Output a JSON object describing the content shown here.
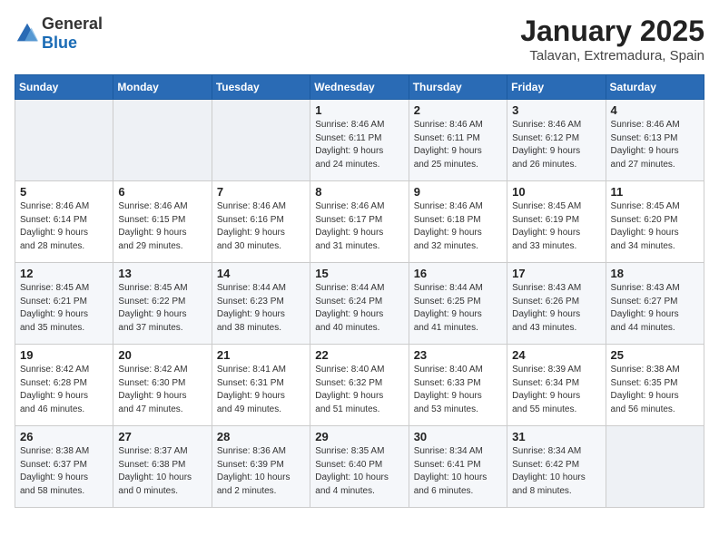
{
  "header": {
    "logo_general": "General",
    "logo_blue": "Blue",
    "title": "January 2025",
    "subtitle": "Talavan, Extremadura, Spain"
  },
  "days_of_week": [
    "Sunday",
    "Monday",
    "Tuesday",
    "Wednesday",
    "Thursday",
    "Friday",
    "Saturday"
  ],
  "weeks": [
    [
      {
        "day": "",
        "info": ""
      },
      {
        "day": "",
        "info": ""
      },
      {
        "day": "",
        "info": ""
      },
      {
        "day": "1",
        "info": "Sunrise: 8:46 AM\nSunset: 6:11 PM\nDaylight: 9 hours\nand 24 minutes."
      },
      {
        "day": "2",
        "info": "Sunrise: 8:46 AM\nSunset: 6:11 PM\nDaylight: 9 hours\nand 25 minutes."
      },
      {
        "day": "3",
        "info": "Sunrise: 8:46 AM\nSunset: 6:12 PM\nDaylight: 9 hours\nand 26 minutes."
      },
      {
        "day": "4",
        "info": "Sunrise: 8:46 AM\nSunset: 6:13 PM\nDaylight: 9 hours\nand 27 minutes."
      }
    ],
    [
      {
        "day": "5",
        "info": "Sunrise: 8:46 AM\nSunset: 6:14 PM\nDaylight: 9 hours\nand 28 minutes."
      },
      {
        "day": "6",
        "info": "Sunrise: 8:46 AM\nSunset: 6:15 PM\nDaylight: 9 hours\nand 29 minutes."
      },
      {
        "day": "7",
        "info": "Sunrise: 8:46 AM\nSunset: 6:16 PM\nDaylight: 9 hours\nand 30 minutes."
      },
      {
        "day": "8",
        "info": "Sunrise: 8:46 AM\nSunset: 6:17 PM\nDaylight: 9 hours\nand 31 minutes."
      },
      {
        "day": "9",
        "info": "Sunrise: 8:46 AM\nSunset: 6:18 PM\nDaylight: 9 hours\nand 32 minutes."
      },
      {
        "day": "10",
        "info": "Sunrise: 8:45 AM\nSunset: 6:19 PM\nDaylight: 9 hours\nand 33 minutes."
      },
      {
        "day": "11",
        "info": "Sunrise: 8:45 AM\nSunset: 6:20 PM\nDaylight: 9 hours\nand 34 minutes."
      }
    ],
    [
      {
        "day": "12",
        "info": "Sunrise: 8:45 AM\nSunset: 6:21 PM\nDaylight: 9 hours\nand 35 minutes."
      },
      {
        "day": "13",
        "info": "Sunrise: 8:45 AM\nSunset: 6:22 PM\nDaylight: 9 hours\nand 37 minutes."
      },
      {
        "day": "14",
        "info": "Sunrise: 8:44 AM\nSunset: 6:23 PM\nDaylight: 9 hours\nand 38 minutes."
      },
      {
        "day": "15",
        "info": "Sunrise: 8:44 AM\nSunset: 6:24 PM\nDaylight: 9 hours\nand 40 minutes."
      },
      {
        "day": "16",
        "info": "Sunrise: 8:44 AM\nSunset: 6:25 PM\nDaylight: 9 hours\nand 41 minutes."
      },
      {
        "day": "17",
        "info": "Sunrise: 8:43 AM\nSunset: 6:26 PM\nDaylight: 9 hours\nand 43 minutes."
      },
      {
        "day": "18",
        "info": "Sunrise: 8:43 AM\nSunset: 6:27 PM\nDaylight: 9 hours\nand 44 minutes."
      }
    ],
    [
      {
        "day": "19",
        "info": "Sunrise: 8:42 AM\nSunset: 6:28 PM\nDaylight: 9 hours\nand 46 minutes."
      },
      {
        "day": "20",
        "info": "Sunrise: 8:42 AM\nSunset: 6:30 PM\nDaylight: 9 hours\nand 47 minutes."
      },
      {
        "day": "21",
        "info": "Sunrise: 8:41 AM\nSunset: 6:31 PM\nDaylight: 9 hours\nand 49 minutes."
      },
      {
        "day": "22",
        "info": "Sunrise: 8:40 AM\nSunset: 6:32 PM\nDaylight: 9 hours\nand 51 minutes."
      },
      {
        "day": "23",
        "info": "Sunrise: 8:40 AM\nSunset: 6:33 PM\nDaylight: 9 hours\nand 53 minutes."
      },
      {
        "day": "24",
        "info": "Sunrise: 8:39 AM\nSunset: 6:34 PM\nDaylight: 9 hours\nand 55 minutes."
      },
      {
        "day": "25",
        "info": "Sunrise: 8:38 AM\nSunset: 6:35 PM\nDaylight: 9 hours\nand 56 minutes."
      }
    ],
    [
      {
        "day": "26",
        "info": "Sunrise: 8:38 AM\nSunset: 6:37 PM\nDaylight: 9 hours\nand 58 minutes."
      },
      {
        "day": "27",
        "info": "Sunrise: 8:37 AM\nSunset: 6:38 PM\nDaylight: 10 hours\nand 0 minutes."
      },
      {
        "day": "28",
        "info": "Sunrise: 8:36 AM\nSunset: 6:39 PM\nDaylight: 10 hours\nand 2 minutes."
      },
      {
        "day": "29",
        "info": "Sunrise: 8:35 AM\nSunset: 6:40 PM\nDaylight: 10 hours\nand 4 minutes."
      },
      {
        "day": "30",
        "info": "Sunrise: 8:34 AM\nSunset: 6:41 PM\nDaylight: 10 hours\nand 6 minutes."
      },
      {
        "day": "31",
        "info": "Sunrise: 8:34 AM\nSunset: 6:42 PM\nDaylight: 10 hours\nand 8 minutes."
      },
      {
        "day": "",
        "info": ""
      }
    ]
  ]
}
